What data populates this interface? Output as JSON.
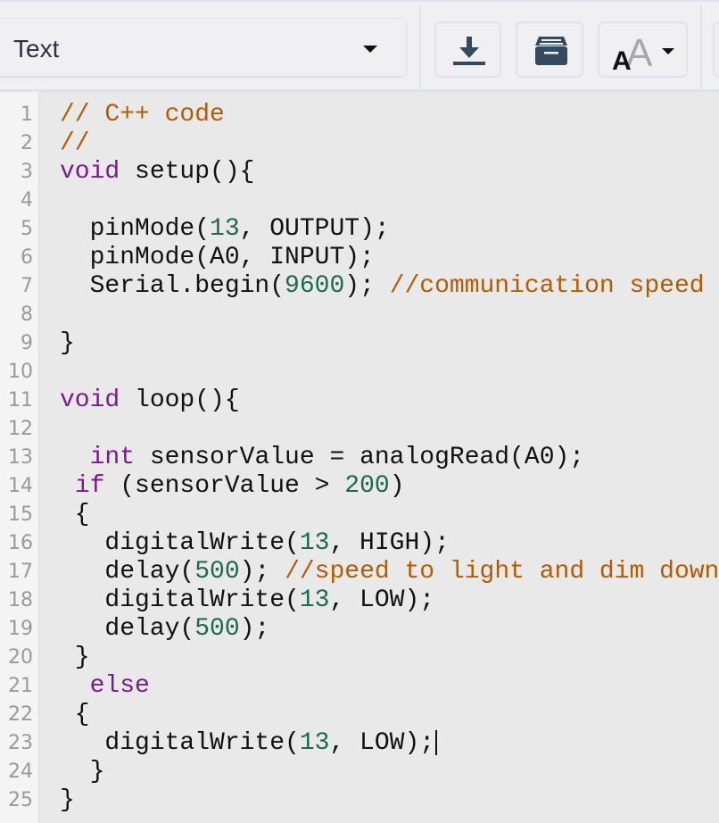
{
  "toolbar": {
    "mode_select": {
      "selected": "Text",
      "icon": "caret-down-icon"
    },
    "buttons": [
      {
        "name": "download-button",
        "icon": "download-icon"
      },
      {
        "name": "library-button",
        "icon": "archive-box-icon"
      },
      {
        "name": "font-size-button",
        "icon": "font-size-icon",
        "has_dropdown": true
      }
    ]
  },
  "colors": {
    "comment": "#b35b00",
    "keyword": "#7a1a8e",
    "number": "#1d6a4f",
    "plain": "#111111",
    "icon": "#344a5e",
    "line_number": "#9a9a9a"
  },
  "editor": {
    "language_comment": "// C++ code",
    "cursor_line": 23,
    "lines": [
      {
        "n": "1",
        "tokens": [
          [
            "comment",
            "// C++ code"
          ]
        ]
      },
      {
        "n": "2",
        "tokens": [
          [
            "comment",
            "//"
          ]
        ]
      },
      {
        "n": "3",
        "tokens": [
          [
            "keyword",
            "void"
          ],
          [
            "plain",
            " setup(){"
          ]
        ]
      },
      {
        "n": "4",
        "tokens": []
      },
      {
        "n": "5",
        "tokens": [
          [
            "plain",
            "  pinMode("
          ],
          [
            "number",
            "13"
          ],
          [
            "plain",
            ", OUTPUT);"
          ]
        ]
      },
      {
        "n": "6",
        "tokens": [
          [
            "plain",
            "  pinMode(A0, INPUT);"
          ]
        ]
      },
      {
        "n": "7",
        "tokens": [
          [
            "plain",
            "  Serial.begin("
          ],
          [
            "number",
            "9600"
          ],
          [
            "plain",
            "); "
          ],
          [
            "comment",
            "//communication speed"
          ]
        ]
      },
      {
        "n": "8",
        "tokens": []
      },
      {
        "n": "9",
        "tokens": [
          [
            "plain",
            "}"
          ]
        ]
      },
      {
        "n": "10",
        "tokens": []
      },
      {
        "n": "11",
        "tokens": [
          [
            "keyword",
            "void"
          ],
          [
            "plain",
            " loop(){"
          ]
        ]
      },
      {
        "n": "12",
        "tokens": []
      },
      {
        "n": "13",
        "tokens": [
          [
            "plain",
            "  "
          ],
          [
            "keyword",
            "int"
          ],
          [
            "plain",
            " sensorValue = analogRead(A0);"
          ]
        ]
      },
      {
        "n": "14",
        "tokens": [
          [
            "plain",
            " "
          ],
          [
            "keyword",
            "if"
          ],
          [
            "plain",
            " (sensorValue > "
          ],
          [
            "number",
            "200"
          ],
          [
            "plain",
            ")"
          ]
        ]
      },
      {
        "n": "15",
        "tokens": [
          [
            "plain",
            " {"
          ]
        ]
      },
      {
        "n": "16",
        "tokens": [
          [
            "plain",
            "   digitalWrite("
          ],
          [
            "number",
            "13"
          ],
          [
            "plain",
            ", HIGH);"
          ]
        ]
      },
      {
        "n": "17",
        "tokens": [
          [
            "plain",
            "   delay("
          ],
          [
            "number",
            "500"
          ],
          [
            "plain",
            "); "
          ],
          [
            "comment",
            "//speed to light and dim down"
          ]
        ]
      },
      {
        "n": "18",
        "tokens": [
          [
            "plain",
            "   digitalWrite("
          ],
          [
            "number",
            "13"
          ],
          [
            "plain",
            ", LOW);"
          ]
        ]
      },
      {
        "n": "19",
        "tokens": [
          [
            "plain",
            "   delay("
          ],
          [
            "number",
            "500"
          ],
          [
            "plain",
            ");"
          ]
        ]
      },
      {
        "n": "20",
        "tokens": [
          [
            "plain",
            " }"
          ]
        ]
      },
      {
        "n": "21",
        "tokens": [
          [
            "plain",
            "  "
          ],
          [
            "keyword",
            "else"
          ]
        ]
      },
      {
        "n": "22",
        "tokens": [
          [
            "plain",
            " {"
          ]
        ]
      },
      {
        "n": "23",
        "tokens": [
          [
            "plain",
            "   digitalWrite("
          ],
          [
            "number",
            "13"
          ],
          [
            "plain",
            ", LOW);"
          ]
        ]
      },
      {
        "n": "24",
        "tokens": [
          [
            "plain",
            "  }"
          ]
        ]
      },
      {
        "n": "25",
        "tokens": [
          [
            "plain",
            "}"
          ]
        ]
      }
    ]
  }
}
